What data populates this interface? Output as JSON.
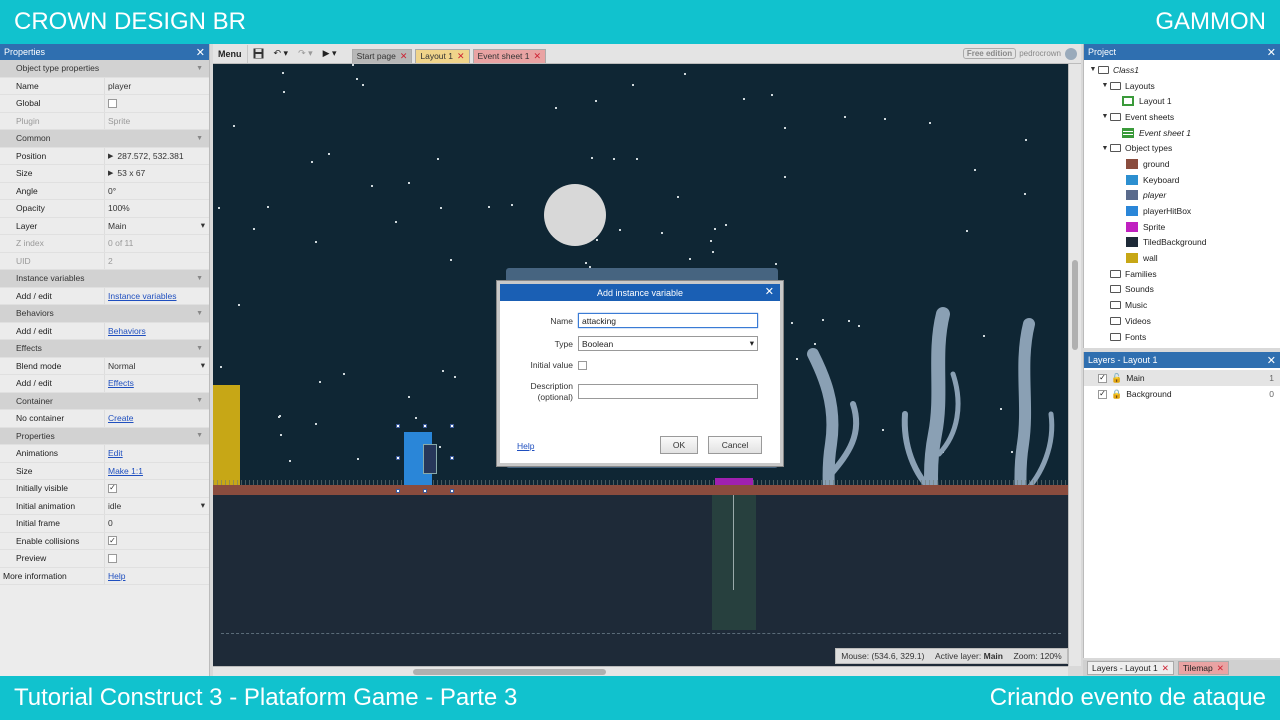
{
  "banner": {
    "top_left": "CROWN DESIGN BR",
    "top_right": "GAMMON",
    "bottom_left": "Tutorial Construct 3 - Plataform Game - Parte 3",
    "bottom_right": "Criando evento de ataque"
  },
  "properties": {
    "title": "Properties",
    "object_type_section": "Object type properties",
    "name_label": "Name",
    "name_value": "player",
    "global_label": "Global",
    "plugin_label": "Plugin",
    "plugin_value": "Sprite",
    "common_section": "Common",
    "position_label": "Position",
    "position_value": "287.572, 532.381",
    "size_label": "Size",
    "size_value": "53 x 67",
    "angle_label": "Angle",
    "angle_value": "0°",
    "opacity_label": "Opacity",
    "opacity_value": "100%",
    "layer_label": "Layer",
    "layer_value": "Main",
    "zindex_label": "Z index",
    "zindex_value": "0 of 11",
    "uid_label": "UID",
    "uid_value": "2",
    "instvars_section": "Instance variables",
    "addedit_label": "Add / edit",
    "instvars_link": "Instance variables",
    "behaviors_section": "Behaviors",
    "behaviors_link": "Behaviors",
    "effects_section": "Effects",
    "blend_label": "Blend mode",
    "blend_value": "Normal",
    "effects_link": "Effects",
    "container_section": "Container",
    "nocontainer_label": "No container",
    "create_link": "Create",
    "props_section": "Properties",
    "animations_label": "Animations",
    "edit_link": "Edit",
    "size2_label": "Size",
    "make_link": "Make 1:1",
    "visible_label": "Initially visible",
    "initanim_label": "Initial animation",
    "initanim_value": "idle",
    "initframe_label": "Initial frame",
    "initframe_value": "0",
    "collisions_label": "Enable collisions",
    "preview_label": "Preview",
    "moreinfo_label": "More information",
    "help_link": "Help"
  },
  "toolbar": {
    "menu": "Menu",
    "tabs": [
      "Start page",
      "Layout 1",
      "Event sheet 1"
    ],
    "free_edition": "Free edition",
    "user": "pedrocrown"
  },
  "dialog": {
    "title": "Add instance variable",
    "name_label": "Name",
    "name_value": "attacking",
    "type_label": "Type",
    "type_value": "Boolean",
    "initial_label": "Initial value",
    "desc_label_1": "Description",
    "desc_label_2": "(optional)",
    "help": "Help",
    "ok": "OK",
    "cancel": "Cancel"
  },
  "status": {
    "mouse": "Mouse: (534.6, 329.1)",
    "active_layer_label": "Active layer:",
    "active_layer_value": "Main",
    "zoom": "Zoom: 120%"
  },
  "project": {
    "title": "Project",
    "root": "Class1",
    "layouts": "Layouts",
    "layout1": "Layout 1",
    "eventsheets": "Event sheets",
    "eventsheet1": "Event sheet 1",
    "objecttypes": "Object types",
    "objects": [
      {
        "name": "ground",
        "color": "#8a4c3e",
        "italic": false
      },
      {
        "name": "Keyboard",
        "color": "#2c8fd0",
        "italic": false
      },
      {
        "name": "player",
        "color": "#5a6b8c",
        "italic": true
      },
      {
        "name": "playerHitBox",
        "color": "#2a86d8",
        "italic": false
      },
      {
        "name": "Sprite",
        "color": "#c020c0",
        "italic": false
      },
      {
        "name": "TiledBackground",
        "color": "#1e2a38",
        "italic": false
      },
      {
        "name": "wall",
        "color": "#c7a716",
        "italic": false
      }
    ],
    "families": "Families",
    "sounds": "Sounds",
    "music": "Music",
    "videos": "Videos",
    "fonts": "Fonts"
  },
  "layers": {
    "title": "Layers - Layout 1",
    "items": [
      {
        "name": "Main",
        "num": "1"
      },
      {
        "name": "Background",
        "num": "0"
      }
    ]
  },
  "bottom_tabs": [
    "Layers - Layout 1",
    "Tilemap"
  ]
}
